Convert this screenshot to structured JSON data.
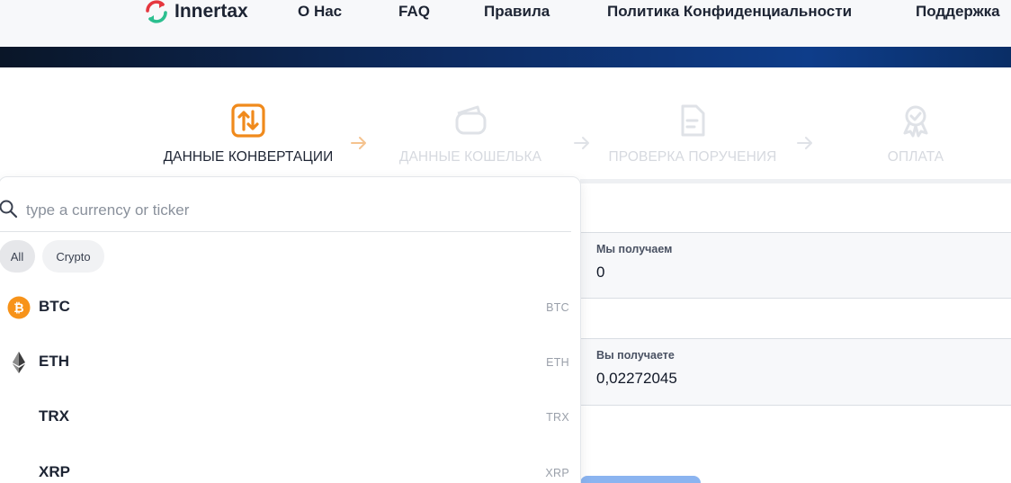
{
  "header": {
    "brand": "Innertax",
    "nav": [
      "О Нас",
      "FAQ",
      "Правила",
      "Политика Конфиденциальности",
      "Поддержка"
    ]
  },
  "steps": [
    {
      "label": "ДАННЫЕ КОНВЕРТАЦИИ",
      "icon": "swap-arrows-icon",
      "state": "active"
    },
    {
      "label": "ДАННЫЕ КОШЕЛЬКА",
      "icon": "wallet-icon",
      "state": "inactive"
    },
    {
      "label": "ПРОВЕРКА ПОРУЧЕНИЯ",
      "icon": "document-icon",
      "state": "inactive"
    },
    {
      "label": "ОПЛАТА",
      "icon": "award-icon",
      "state": "inactive"
    }
  ],
  "form": {
    "we_receive": {
      "label": "Мы получаем",
      "value": "0"
    },
    "you_receive": {
      "label": "Вы получаете",
      "value": "0,02272045"
    }
  },
  "dropdown": {
    "search_placeholder": "type a currency or ticker",
    "filters": [
      {
        "label": "All",
        "selected": true
      },
      {
        "label": "Crypto",
        "selected": false
      }
    ],
    "currencies": [
      {
        "name": "BTC",
        "ticker": "BTC",
        "icon": "bitcoin-icon"
      },
      {
        "name": "ETH",
        "ticker": "ETH",
        "icon": "ethereum-icon"
      },
      {
        "name": "TRX",
        "ticker": "TRX",
        "icon": ""
      },
      {
        "name": "XRP",
        "ticker": "XRP",
        "icon": ""
      }
    ]
  },
  "colors": {
    "accent": "#f08a1c",
    "band_dark": "#0a1628",
    "band_blue": "#0e3d8a",
    "inactive_step": "#d6d9df",
    "button": "#8bb4f0"
  }
}
